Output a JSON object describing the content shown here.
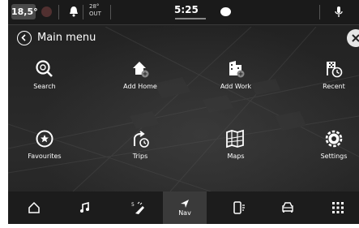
{
  "status_bar": {
    "temperature": "18,5°",
    "outside_temp": "28°",
    "outside_label": "OUT",
    "time": "5:25"
  },
  "header": {
    "title": "Main menu"
  },
  "menu_items": [
    {
      "label": "Search",
      "icon": "search-icon"
    },
    {
      "label": "Add Home",
      "icon": "home-add-icon"
    },
    {
      "label": "Add Work",
      "icon": "work-add-icon"
    },
    {
      "label": "Recent",
      "icon": "recent-icon"
    },
    {
      "label": "Favourites",
      "icon": "star-icon"
    },
    {
      "label": "Trips",
      "icon": "trips-icon"
    },
    {
      "label": "Maps",
      "icon": "map-icon"
    },
    {
      "label": "Settings",
      "icon": "settings-icon"
    }
  ],
  "bottom_nav": {
    "items": [
      {
        "icon": "home-icon"
      },
      {
        "icon": "music-icon"
      },
      {
        "icon": "phone-icon",
        "badge": "5"
      },
      {
        "icon": "nav-icon",
        "label": "Nav",
        "active": true
      },
      {
        "icon": "mobile-icon"
      },
      {
        "icon": "car-icon"
      },
      {
        "icon": "apps-grid-icon"
      }
    ]
  },
  "colors": {
    "background": "#262626",
    "status_bar": "#1a1a1a",
    "nav_bar": "#1c1c1c",
    "nav_active": "#3a3a3a",
    "text": "#ffffff"
  }
}
